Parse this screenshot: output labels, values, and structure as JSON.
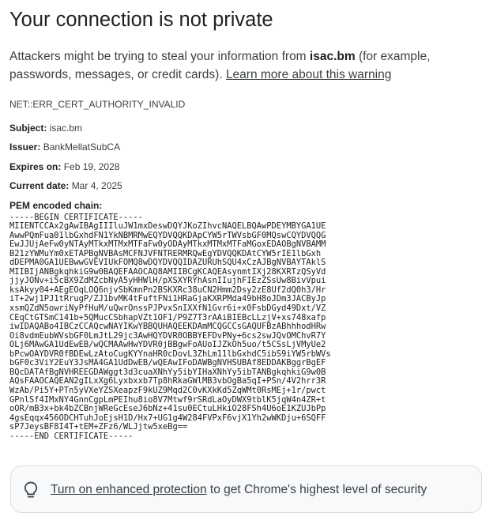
{
  "heading": {
    "title": "Your connection is not private"
  },
  "intro": {
    "prefix": "Attackers might be trying to steal your information from ",
    "host": "isac.bm",
    "suffix": " (for example, passwords, messages, or credit cards). ",
    "learn_more": "Learn more about this warning"
  },
  "error_code": "NET::ERR_CERT_AUTHORITY_INVALID",
  "cert": {
    "subject_label": "Subject:",
    "subject": "isac.bm",
    "issuer_label": "Issuer:",
    "issuer": "BankMellatSubCA",
    "expires_label": "Expires on:",
    "expires": "Feb 19, 2028",
    "current_label": "Current date:",
    "current": "Mar 4, 2025",
    "pem_label": "PEM encoded chain:",
    "pem": "-----BEGIN CERTIFICATE-----\nMIIENTCCAx2gAwIBAgIIIluJW1mxDeswDQYJKoZIhvcNAQELBQAwPDEYMBYGA1UE\nAwwPQmFua01lbGxhdFN1YkNBMRMwEQYDVQQKDApCYW5rTWVsbGF0MQswCQYDVQQG\nEwJJUjAeFw0yNTAyMTkxMTMxMTFaFw0yODAyMTkxMTMxMTFaMGoxEDAOBgNVBAMM\nB21zYWMuYm0xETAPBgNVBAsMCFNJVFNTRERMRQwEgYDVQQKDAtCYW5rIE1lbGxh\ndDEPMA0GA1UEBwwGVEVIUkFOMQ8wDQYDVQQIDAZURUhSQU4xCzAJBgNVBAYTAklS\nMIIBIjANBgkqhkiG9w0BAQEFAAOCAQ8AMIIBCgKCAQEAsynmtIXj28KXRTzQSyVd\njjyJONv+i5cBX9ZdMZcbNyA5yHHWlH/pXSXYRYhAsnIIujhFIEzZSsUw8BivVpui\nksAkyy04+AEgEOqLOQ6njvSbKmnPn2BSKXRc38uCN2Hmm2Dsy2zE8Uf2dQ0h3/Hr\niT+2wj1PJ1tRrugP/ZJ1bvMK4tFuftFNi1HRaGjaKXRPMda49bH8oJDm3JACByJp\nxsmQZdN5owriNyPfHuM/uQwrOnssPJPvxSnIXXfN1Gvr6i+x0FsbDGyd49Dxt/VZ\nCEqCtGTSmC141b+5QMucCSbhapVZt1OF1/P9Z7T3rAAiBIEBcLLzjV+xs748xafp\niwIDAQABo4IBCzCCAQcwNAYIKwYBBQUHAQEEKDAmMCQGCCsGAQUFBzABhhhodHRw\nOi8vdmEubWVsbGF0LmJtL29jc3AwHQYDVR0OBBYEFDvPNy+6cs2swJQvOMChvR7Y\nOLj6MAwGA1UdEwEB/wQCMAAwHwYDVR0jBBgwFoAUoIJZkOh5uo/t5CSsLjVMyUe2\nbPcwOAYDVR0fBDEwLzAtoCugKYYnaHR0cDovL3ZhLm11lbGxhdC5ibS9iYW5rbWVs\nbGF0c3ViY2EuY3JsMA4GA1UdDwEB/wQEAwIFoDAWBgNVHSUBAf8EDDAKBggrBgEF\nBQcDATAfBgNVHREEGDAWggt3d3cuaXNhYy5ibYIHaXNhYy5ibTANBgkqhkiG9w0B\nAQsFAAOCAQEAN2gILxXg6Lyxbxxb7Tp8hRkaGWlMB3vbOgBa5qI+PSn/4V2hrr3R\nWzAb/Pi5Y+PTn5yVXeYZSXeapzF9kUZ9Mqd2C0vKXkKd5ZqWMt0RsMEj+1r/pwct\nGPnlSf4IMxNY4GnnCgpLmPEIhu8io8V7Mtwf9rSRdLaOyDWX9tblK5jqW4n4ZR+t\noOR/mB3x+bk4bZCBnjWReGcEseJ6bNz+41su0ECtuLHkiO28FSh4U6oE1KZUJbPp\n4gsEqqx456ODCHTuhJoEjsH1D/Hx7+UG1g4W284FVPxF6vjX1Yh2wWKDju+6SQFF\nsP7JeysBF8I4T+tEM+ZFz6/WLJjtw5xeBg==\n-----END CERTIFICATE-----"
  },
  "protection": {
    "link": "Turn on enhanced protection",
    "rest": " to get Chrome's highest level of security"
  }
}
